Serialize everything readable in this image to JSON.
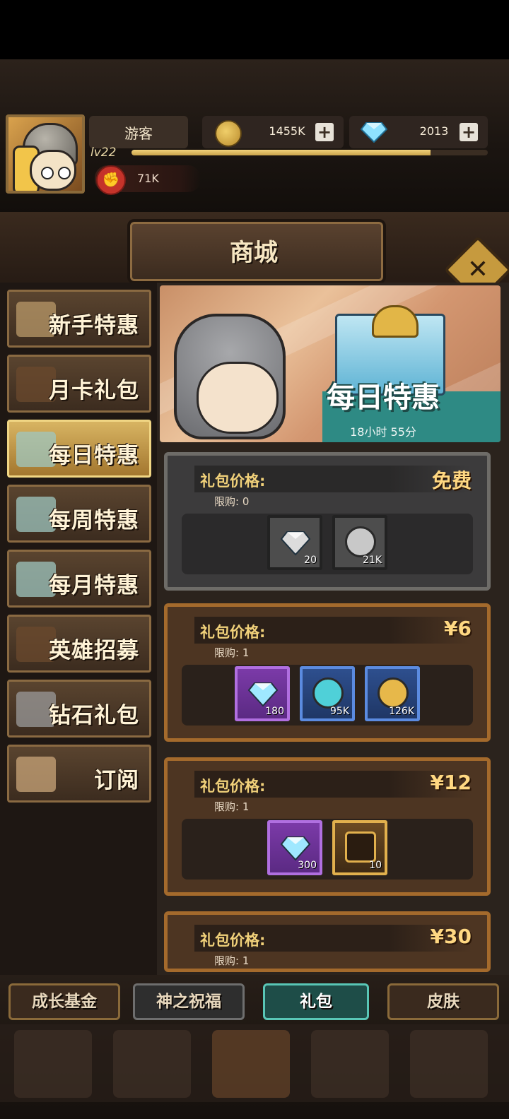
{
  "header": {
    "player_name": "游客",
    "level": "lv22",
    "xp_progress": 0.84,
    "gold": "1455K",
    "diamonds": "2013",
    "power": "71K"
  },
  "title": "商城",
  "sidebar": {
    "items": [
      {
        "label": "新手特惠",
        "active": false,
        "icon": "sale-tag-icon"
      },
      {
        "label": "月卡礼包",
        "active": false,
        "icon": "card-icon"
      },
      {
        "label": "每日特惠",
        "active": true,
        "icon": "gift-box-icon"
      },
      {
        "label": "每周特惠",
        "active": false,
        "icon": "gift-box-icon"
      },
      {
        "label": "每月特惠",
        "active": false,
        "icon": "gift-box-icon"
      },
      {
        "label": "英雄招募",
        "active": false,
        "icon": "card-icon"
      },
      {
        "label": "钻石礼包",
        "active": false,
        "icon": "stones-icon"
      },
      {
        "label": "订阅",
        "active": false,
        "icon": "scroll-icon"
      }
    ]
  },
  "banner": {
    "title": "每日特惠",
    "timer": "18小时 55分"
  },
  "packs": [
    {
      "price_label": "礼包价格:",
      "price": "免费",
      "limit": "限购: 0",
      "items": [
        {
          "icon": "diamond-icon",
          "qty": "20"
        },
        {
          "icon": "silver-coin-icon",
          "qty": "21K"
        }
      ]
    },
    {
      "price_label": "礼包价格:",
      "price": "¥6",
      "limit": "限购: 1",
      "items": [
        {
          "icon": "diamond-icon",
          "qty": "180"
        },
        {
          "icon": "blue-orb-icon",
          "qty": "95K"
        },
        {
          "icon": "gold-coin-icon",
          "qty": "126K"
        }
      ]
    },
    {
      "price_label": "礼包价格:",
      "price": "¥12",
      "limit": "限购: 1",
      "items": [
        {
          "icon": "diamond-icon",
          "qty": "300"
        },
        {
          "icon": "hero-shard-icon",
          "qty": "10"
        }
      ]
    },
    {
      "price_label": "礼包价格:",
      "price": "¥30",
      "limit": "限购: 1",
      "items": []
    }
  ],
  "tabs": [
    {
      "label": "成长基金"
    },
    {
      "label": "神之祝福"
    },
    {
      "label": "礼包"
    },
    {
      "label": "皮肤"
    }
  ],
  "colors": {
    "accent_gold": "#f1d17a",
    "active_tab": "#59c6b6",
    "active_menu": "#d8b462"
  }
}
